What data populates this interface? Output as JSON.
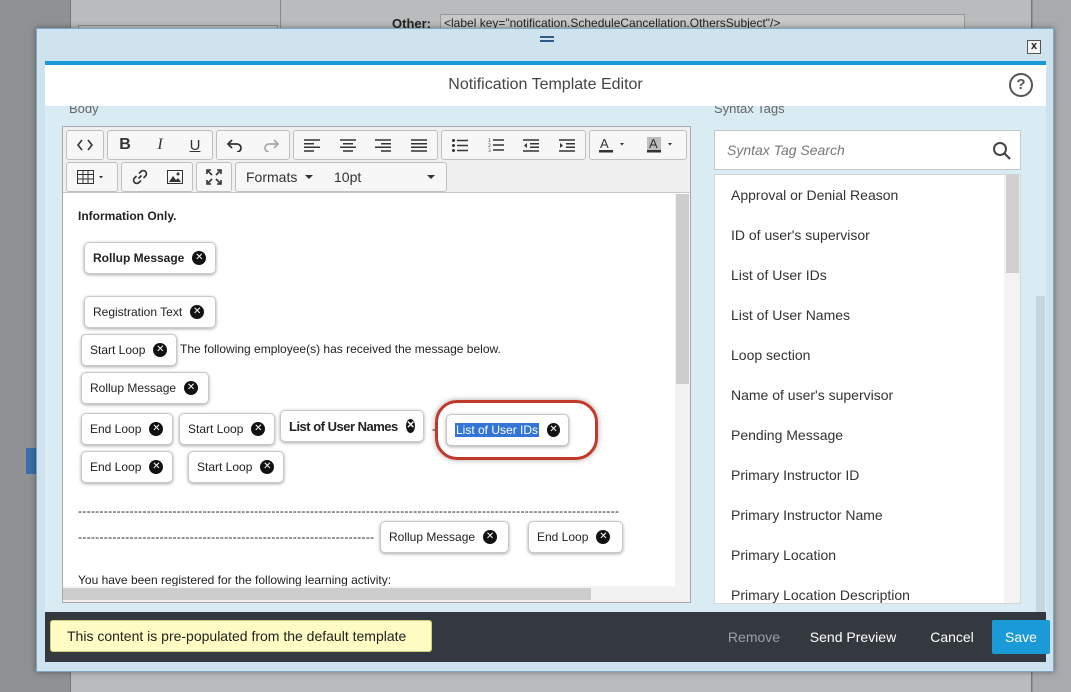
{
  "background": {
    "other_label": "Other:",
    "other_value": "<label key=\"notification.ScheduleCancellation.OthersSubject\"/>"
  },
  "dialog": {
    "title": "Notification Template Editor",
    "help_icon": "?",
    "close_icon": "x"
  },
  "sections": {
    "body_label": "Body",
    "syntax_label": "Syntax Tags"
  },
  "toolbar": {
    "formats_label": "Formats",
    "font_size": "10pt",
    "icons": [
      "source-code-icon",
      "bold-icon",
      "italic-icon",
      "underline-icon",
      "undo-icon",
      "redo-icon",
      "align-left-icon",
      "align-center-icon",
      "align-right-icon",
      "justify-icon",
      "bullet-list-icon",
      "numbered-list-icon",
      "outdent-icon",
      "indent-icon",
      "text-color-icon",
      "background-color-icon",
      "table-icon",
      "link-icon",
      "image-icon",
      "fullscreen-icon"
    ]
  },
  "editor": {
    "heading": "Information Only.",
    "line_text": "The following employee(s) has received the message below.",
    "dash_line_1": "------------------------------------------------------------------------------------------------------------------------------",
    "dash_line_2": "----------------------------------------------------------------------------------",
    "dash_sep": "-",
    "footer_text": "You have been registered for the following learning activity:",
    "tags": {
      "rollup_message_1": "Rollup Message",
      "registration_text": "Registration Text",
      "start_loop_1": "Start Loop",
      "rollup_message_2": "Rollup Message",
      "end_loop_1": "End Loop",
      "start_loop_2": "Start Loop",
      "list_user_names": "List of User Names",
      "list_user_ids": "List of User IDs",
      "end_loop_2": "End Loop",
      "start_loop_3": "Start Loop",
      "rollup_message_3": "Rollup Message",
      "end_loop_3": "End Loop"
    }
  },
  "syntax": {
    "search_placeholder": "Syntax Tag Search",
    "items": [
      "Approval or Denial Reason",
      "ID of user's supervisor",
      "List of User IDs",
      "List of User Names",
      "Loop section",
      "Name of user's supervisor",
      "Pending Message",
      "Primary Instructor ID",
      "Primary Instructor Name",
      "Primary Location",
      "Primary Location Description"
    ]
  },
  "footer": {
    "notice": "This content is pre-populated from the default template",
    "remove": "Remove",
    "send_preview": "Send Preview",
    "cancel": "Cancel",
    "save": "Save"
  },
  "colors": {
    "accent": "#1a9ad6",
    "footer_bg": "#34393f",
    "highlight_ring": "#c0392b",
    "selection": "#3375d6",
    "notice_bg": "#fffdc4"
  }
}
